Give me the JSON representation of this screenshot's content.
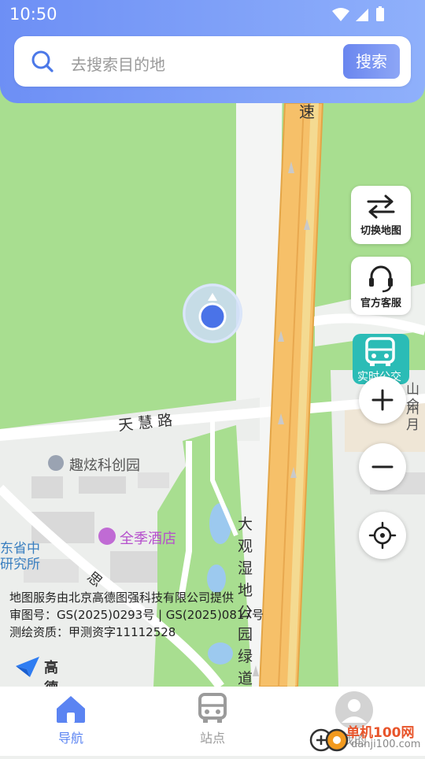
{
  "status_bar": {
    "time": "10:50"
  },
  "search": {
    "placeholder": "去搜索目的地",
    "button_label": "搜索"
  },
  "map": {
    "road_labels": [
      "速",
      "天慧路",
      "大观湿地公园绿道"
    ],
    "poi_labels": [
      "趣炫科创园",
      "全季酒店",
      "东省中",
      "研究所",
      "山川",
      "会月",
      "思"
    ],
    "copyright_lines": [
      "地图服务由北京高德图强科技有限公司提供",
      "审图号：GS(2025)0293号 | GS(2025)0817号",
      "测绘资质：甲测资字11112528"
    ],
    "logo_text": "高德地图"
  },
  "side_buttons": {
    "switch_map": "切换地图",
    "customer_service": "官方客服",
    "realtime_bus": "实时公交"
  },
  "bottom_nav": {
    "items": [
      {
        "label": "导航",
        "active": true
      },
      {
        "label": "站点",
        "active": false
      },
      {
        "label": "我的",
        "active": false
      }
    ]
  },
  "watermark": {
    "text": "单机100网",
    "url": "danji100.com"
  },
  "colors": {
    "accent": "#5b84f2",
    "park_green": "#a6de8f",
    "highway_orange": "#f6c069",
    "bus_teal": "#2bbcb6"
  }
}
